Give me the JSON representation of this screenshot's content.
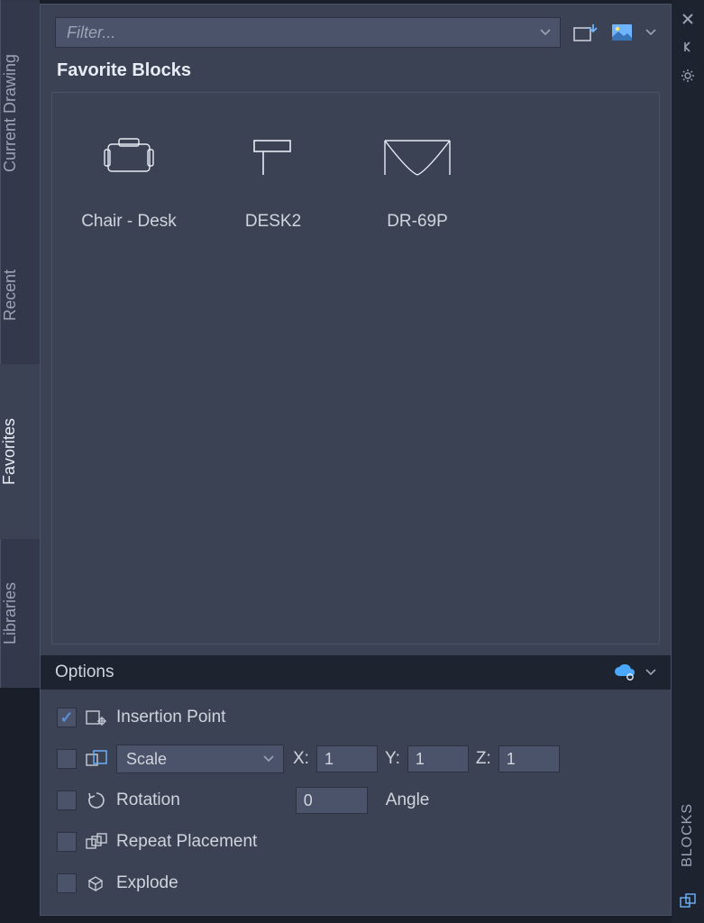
{
  "left_tabs": {
    "current_drawing": "Current Drawing",
    "recent": "Recent",
    "favorites": "Favorites",
    "libraries": "Libraries"
  },
  "right_rail": {
    "label": "BLOCKS"
  },
  "toolbar": {
    "filter_placeholder": "Filter..."
  },
  "section": {
    "heading": "Favorite Blocks"
  },
  "blocks": [
    {
      "label": "Chair - Desk"
    },
    {
      "label": "DESK2"
    },
    {
      "label": "DR-69P"
    }
  ],
  "options": {
    "title": "Options",
    "insertion_point": "Insertion Point",
    "scale_label": "Scale",
    "x_label": "X:",
    "x_value": "1",
    "y_label": "Y:",
    "y_value": "1",
    "z_label": "Z:",
    "z_value": "1",
    "rotation_label": "Rotation",
    "rotation_value": "0",
    "angle_label": "Angle",
    "repeat": "Repeat Placement",
    "explode": "Explode"
  }
}
